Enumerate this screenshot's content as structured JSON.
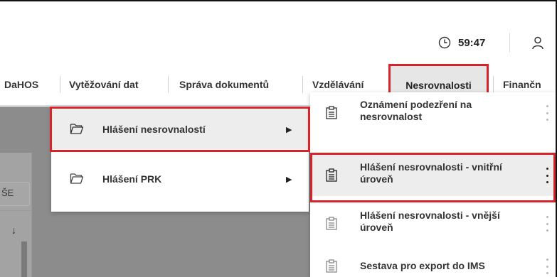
{
  "header": {
    "timer": {
      "icon": "clock-icon",
      "value": "59:47"
    },
    "user": {
      "icon": "user-icon"
    }
  },
  "navbar": {
    "items": [
      {
        "label": "DaHOS"
      },
      {
        "label": "Vytěžování dat"
      },
      {
        "label": "Správa dokumentů"
      },
      {
        "label": "Vzdělávání"
      },
      {
        "label": "Nesrovnalosti",
        "active": true
      },
      {
        "label": "Finančn"
      }
    ]
  },
  "background": {
    "tab_label": "ŠE",
    "sort_icon": "arrow-down-icon"
  },
  "menu_level1": {
    "items": [
      {
        "label": "Hlášení nesrovnalostí",
        "icon": "folder-icon",
        "submenu_icon": "triangle-right-icon",
        "highlighted": true
      },
      {
        "label": "Hlášení PRK",
        "icon": "folder-icon",
        "submenu_icon": "triangle-right-icon",
        "highlighted": false
      }
    ]
  },
  "menu_level2": {
    "items": [
      {
        "label": "Oznámení podezření na nesrovnalost",
        "icon": "clipboard-icon",
        "menu_icon": "kebab-icon"
      },
      {
        "label": "Hlášení nesrovnalosti - vnitřní úroveň",
        "icon": "clipboard-icon",
        "menu_icon": "kebab-icon",
        "highlighted": true
      },
      {
        "label": "Hlášení nesrovnalosti - vnější úroveň",
        "icon": "clipboard-icon",
        "menu_icon": "kebab-icon"
      },
      {
        "label": "Sestava pro export do IMS",
        "icon": "clipboard-icon",
        "menu_icon": "kebab-icon"
      }
    ]
  },
  "colors": {
    "highlight_outline": "#d7232b",
    "overlay": "#8c8c8c",
    "active_tab_bg": "#e6e6e6",
    "hover_bg": "#ededed"
  }
}
